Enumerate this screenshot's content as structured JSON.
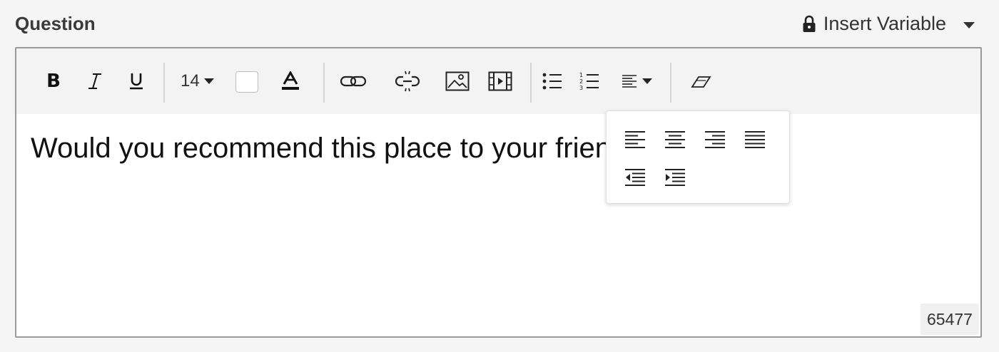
{
  "header": {
    "label": "Question",
    "insert_variable": {
      "label": "Insert Variable",
      "icon": "lock-icon"
    }
  },
  "toolbar": {
    "bold": "B",
    "font_size": "14",
    "tooltips": {
      "bold": "Bold",
      "italic": "Italic",
      "underline": "Underline",
      "font_size": "Font size",
      "background_color": "Background color",
      "font_color": "Font color",
      "link": "Insert link",
      "unlink": "Remove link",
      "image": "Insert image",
      "video": "Insert video",
      "bullet_list": "Bulleted list",
      "numbered_list": "Numbered list",
      "align": "Alignment",
      "clear_format": "Clear formatting"
    },
    "background_color_value": "#ffffff"
  },
  "editor": {
    "content": "Would you recommend this place to your friend?",
    "char_count": "65477"
  },
  "align_menu": {
    "items": [
      "align-left",
      "align-center",
      "align-right",
      "align-justify",
      "outdent",
      "indent"
    ]
  }
}
